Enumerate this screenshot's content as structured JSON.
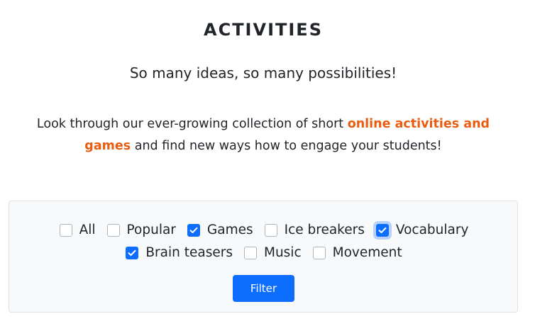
{
  "header": {
    "title": "ACTIVITIES",
    "subtitle": "So many ideas, so many possibilities!"
  },
  "intro": {
    "text_before": "Look through our ever-growing collection of short ",
    "highlight": "online activities and games",
    "text_after": " and find new ways how to engage your students!",
    "highlight_color": "#e85d12"
  },
  "filters": {
    "options": [
      {
        "label": "All",
        "checked": false
      },
      {
        "label": "Popular",
        "checked": false
      },
      {
        "label": "Games",
        "checked": true
      },
      {
        "label": "Ice breakers",
        "checked": false
      },
      {
        "label": "Vocabulary",
        "checked": true,
        "focused": true
      },
      {
        "label": "Brain teasers",
        "checked": true
      },
      {
        "label": "Music",
        "checked": false
      },
      {
        "label": "Movement",
        "checked": false
      }
    ],
    "button_label": "Filter",
    "accent_color": "#0d6efd"
  }
}
